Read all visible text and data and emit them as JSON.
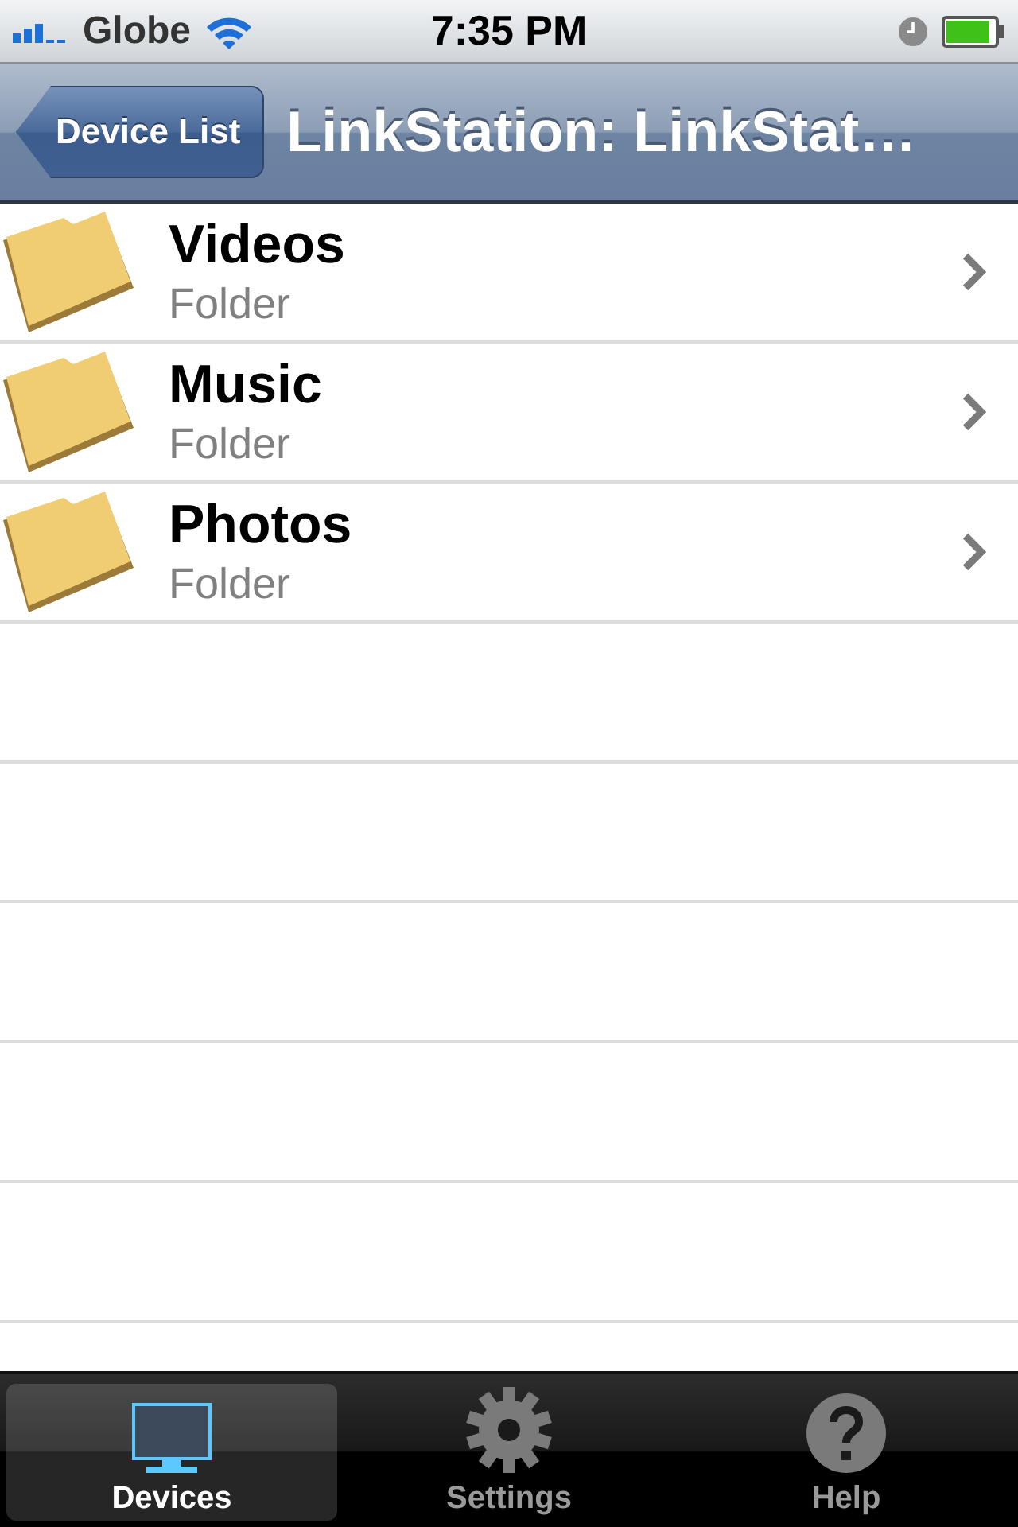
{
  "status_bar": {
    "carrier": "Globe",
    "time": "7:35 PM"
  },
  "nav_bar": {
    "back_button": "Device List",
    "title": "LinkStation: LinkStat…"
  },
  "list": [
    {
      "title": "Videos",
      "subtitle": "Folder"
    },
    {
      "title": "Music",
      "subtitle": "Folder"
    },
    {
      "title": "Photos",
      "subtitle": "Folder"
    }
  ],
  "tab_bar": [
    {
      "label": "Devices",
      "kind": "monitor",
      "selected": true
    },
    {
      "label": "Settings",
      "kind": "gear",
      "selected": false
    },
    {
      "label": "Help",
      "kind": "help",
      "selected": false
    }
  ]
}
